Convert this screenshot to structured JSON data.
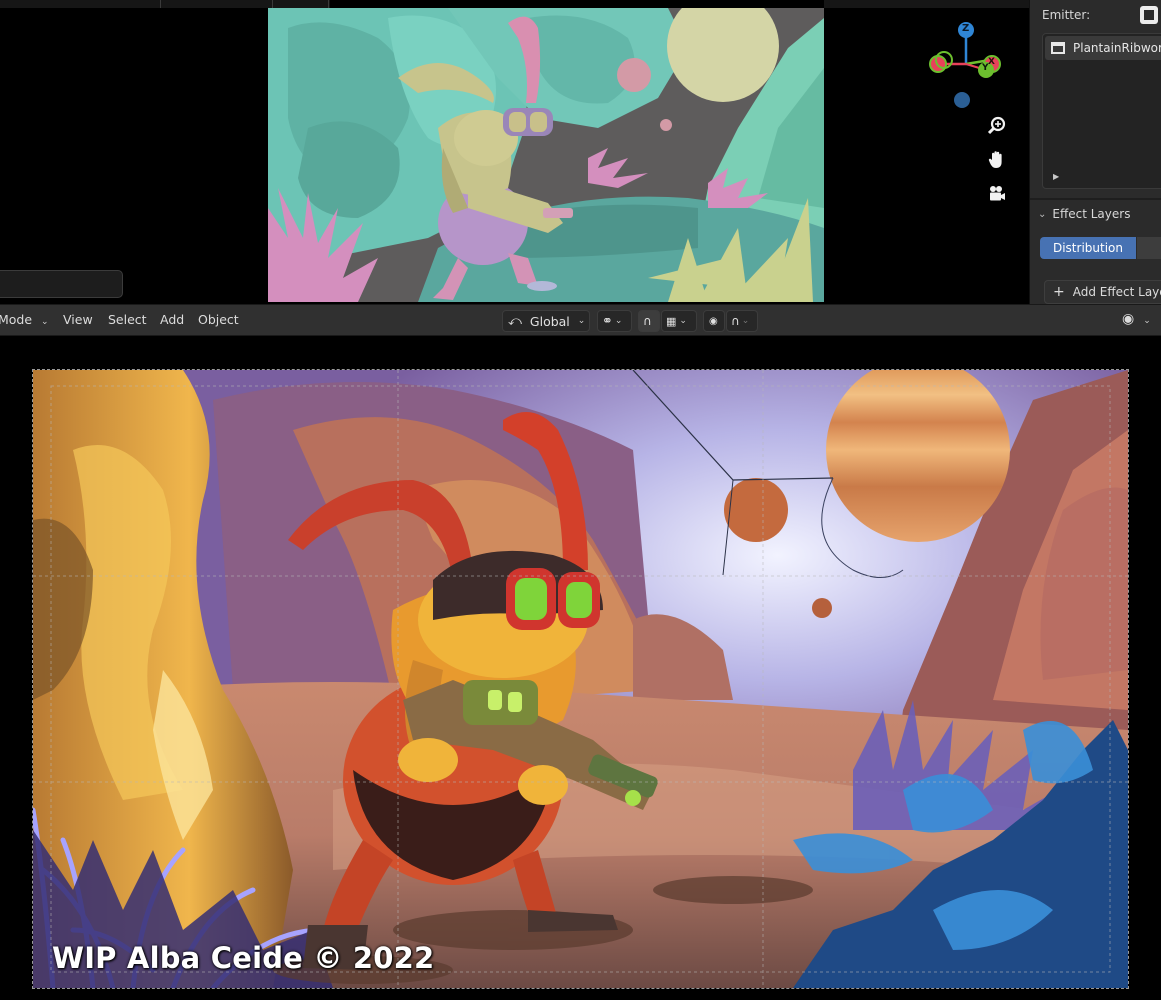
{
  "panel": {
    "emitter_label": "Emitter:",
    "emitter_item": "PlantainRibwort",
    "effect_layers_label": "Effect Layers",
    "effect_tab": "Distribution",
    "add_effect_layer": "Add Effect Laye"
  },
  "header": {
    "mode": "Mode",
    "menus": [
      "View",
      "Select",
      "Add",
      "Object"
    ],
    "transform_orientation": "Global"
  },
  "gizmo": {
    "z_label": "Z",
    "y_label": "Y",
    "x_label": "X"
  },
  "icons": {
    "zoom": "zoom-icon",
    "pan": "hand-icon",
    "camera": "camera-icon"
  },
  "colors": {
    "accent_blue": "#4772b3",
    "axis_x": "#e8415a",
    "axis_y": "#6cbf2e",
    "axis_z": "#2f86d6"
  },
  "watermark": "WIP Alba Ceide © 2022"
}
